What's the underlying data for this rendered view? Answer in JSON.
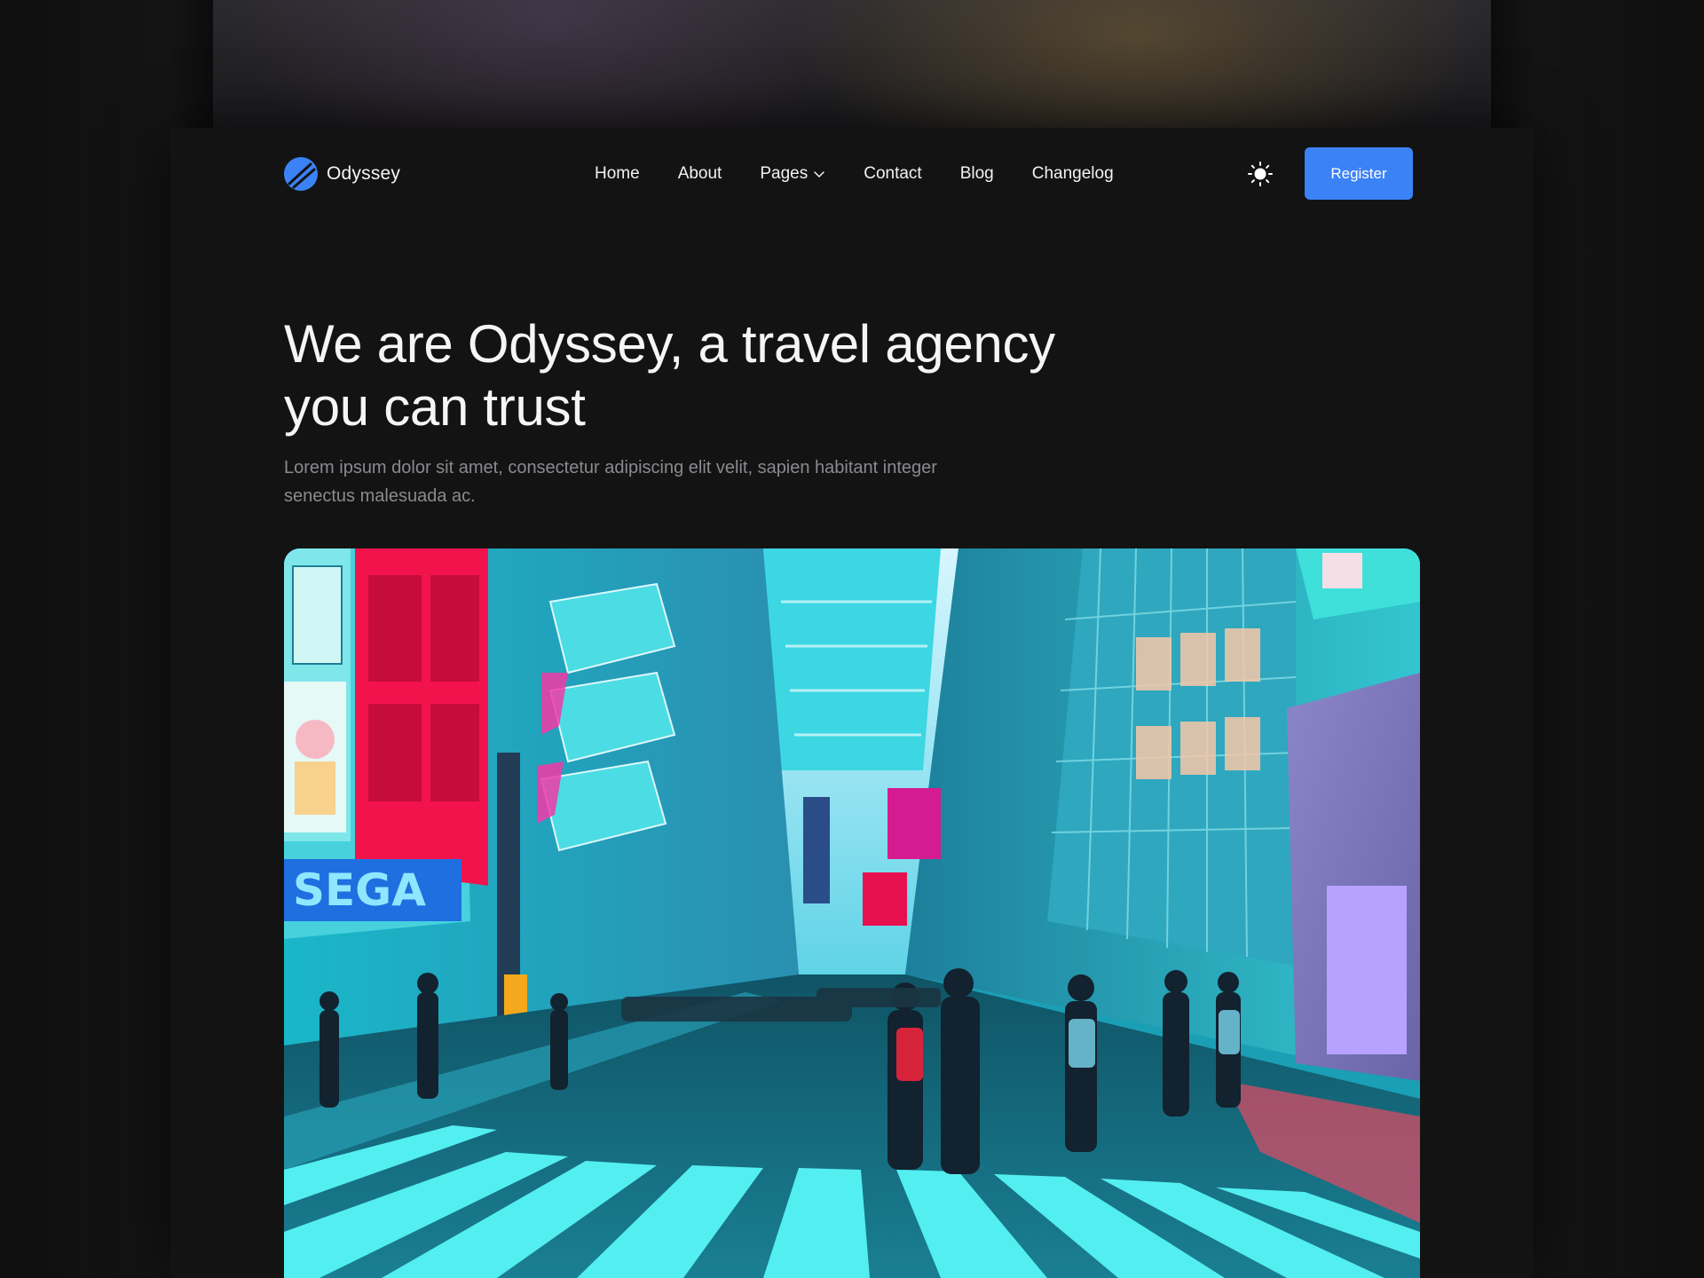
{
  "brand": {
    "name": "Odyssey",
    "accent_color": "#3b82f6",
    "logo_icon": "odyssey-logo-icon"
  },
  "nav": {
    "items": [
      {
        "label": "Home"
      },
      {
        "label": "About"
      },
      {
        "label": "Pages",
        "has_dropdown": true,
        "icon": "chevron-down-icon"
      },
      {
        "label": "Contact"
      },
      {
        "label": "Blog"
      },
      {
        "label": "Changelog"
      }
    ],
    "theme_toggle_icon": "sun-icon",
    "register_label": "Register"
  },
  "hero": {
    "title": "We are Odyssey, a travel agency you can trust",
    "subtitle": "Lorem ipsum dolor sit amet, consectetur adipiscing elit velit, sapien habitant integer senectus malesuada ac.",
    "image_subject": "neon-city-street-crosswalk-photo"
  },
  "colors": {
    "page_background": "#131314",
    "text_primary": "#f5f5f6",
    "text_muted": "#8a8a8f"
  }
}
